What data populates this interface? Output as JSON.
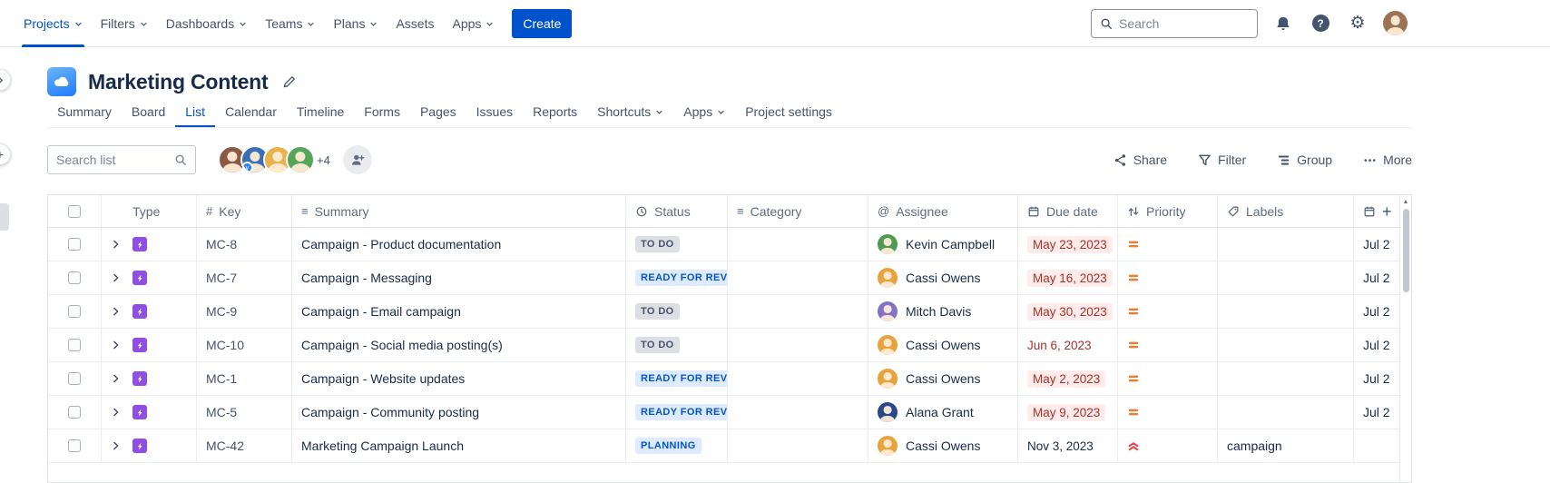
{
  "nav": {
    "items": [
      {
        "label": "Projects",
        "chevron": true,
        "active": true
      },
      {
        "label": "Filters",
        "chevron": true
      },
      {
        "label": "Dashboards",
        "chevron": true
      },
      {
        "label": "Teams",
        "chevron": true
      },
      {
        "label": "Plans",
        "chevron": true
      },
      {
        "label": "Assets",
        "chevron": false
      },
      {
        "label": "Apps",
        "chevron": true
      }
    ],
    "create_label": "Create",
    "search_placeholder": "Search"
  },
  "project": {
    "title": "Marketing Content",
    "tabs": [
      {
        "label": "Summary"
      },
      {
        "label": "Board"
      },
      {
        "label": "List",
        "active": true
      },
      {
        "label": "Calendar"
      },
      {
        "label": "Timeline"
      },
      {
        "label": "Forms"
      },
      {
        "label": "Pages"
      },
      {
        "label": "Issues"
      },
      {
        "label": "Reports"
      },
      {
        "label": "Shortcuts",
        "chevron": true
      },
      {
        "label": "Apps",
        "chevron": true
      },
      {
        "label": "Project settings"
      }
    ]
  },
  "toolbar": {
    "search_placeholder": "Search list",
    "avatars": [
      {
        "color": "#8A5A44"
      },
      {
        "color": "#3B6FB5",
        "badge": "v"
      },
      {
        "color": "#E8B34B"
      },
      {
        "color": "#55A55A"
      }
    ],
    "overflow": "+4",
    "actions": [
      {
        "label": "Share",
        "icon": "share-icon"
      },
      {
        "label": "Filter",
        "icon": "filter-icon"
      },
      {
        "label": "Group",
        "icon": "group-icon"
      },
      {
        "label": "More",
        "icon": "more-icon"
      }
    ]
  },
  "table": {
    "columns": [
      {
        "label": ""
      },
      {
        "label": "Type"
      },
      {
        "label": "Key",
        "icon": "hash-icon"
      },
      {
        "label": "Summary",
        "icon": "lines-icon"
      },
      {
        "label": "Status",
        "icon": "status-icon"
      },
      {
        "label": "Category",
        "icon": "lines-icon"
      },
      {
        "label": "Assignee",
        "icon": "at-icon"
      },
      {
        "label": "Due date",
        "icon": "calendar-icon"
      },
      {
        "label": "Priority",
        "icon": "priority-icon"
      },
      {
        "label": "Labels",
        "icon": "tag-icon"
      },
      {
        "label": "",
        "icon": "calendar-icon"
      }
    ],
    "rows": [
      {
        "key": "MC-8",
        "summary": "Campaign - Product documentation",
        "status": "TO DO",
        "status_variant": "gray",
        "assignee": "Kevin Campbell",
        "assignee_color": "#4E9B51",
        "due": "May 23, 2023",
        "due_style": "overdue-pill",
        "priority": "medium",
        "labels": "",
        "date2": "Jul 2"
      },
      {
        "key": "MC-7",
        "summary": "Campaign - Messaging",
        "status": "READY FOR REVI...",
        "status_variant": "blue",
        "assignee": "Cassi Owens",
        "assignee_color": "#E8A33D",
        "due": "May 16, 2023",
        "due_style": "overdue-pill",
        "priority": "medium",
        "labels": "",
        "date2": "Jul 2"
      },
      {
        "key": "MC-9",
        "summary": "Campaign - Email campaign",
        "status": "TO DO",
        "status_variant": "gray",
        "assignee": "Mitch Davis",
        "assignee_color": "#8273C9",
        "due": "May 30, 2023",
        "due_style": "overdue-pill",
        "priority": "medium",
        "labels": "",
        "date2": "Jul 2"
      },
      {
        "key": "MC-10",
        "summary": "Campaign - Social media posting(s)",
        "status": "TO DO",
        "status_variant": "gray",
        "assignee": "Cassi Owens",
        "assignee_color": "#E8A33D",
        "due": "Jun 6, 2023",
        "due_style": "overdue-text",
        "priority": "medium",
        "labels": "",
        "date2": "Jul 2"
      },
      {
        "key": "MC-1",
        "summary": "Campaign - Website updates",
        "status": "READY FOR REVI...",
        "status_variant": "blue",
        "assignee": "Cassi Owens",
        "assignee_color": "#E8A33D",
        "due": "May 2, 2023",
        "due_style": "overdue-pill",
        "priority": "medium",
        "labels": "",
        "date2": "Jul 2"
      },
      {
        "key": "MC-5",
        "summary": "Campaign - Community posting",
        "status": "READY FOR REVI...",
        "status_variant": "blue",
        "assignee": "Alana Grant",
        "assignee_color": "#27488A",
        "due": "May 9, 2023",
        "due_style": "overdue-pill",
        "priority": "medium",
        "labels": "",
        "date2": "Jul 2"
      },
      {
        "key": "MC-42",
        "summary": "Marketing Campaign Launch",
        "status": "PLANNING",
        "status_variant": "blue",
        "assignee": "Cassi Owens",
        "assignee_color": "#E8A33D",
        "due": "Nov 3, 2023",
        "due_style": "normal",
        "priority": "high",
        "labels": "campaign",
        "date2": "",
        "expandable": true
      }
    ]
  },
  "colors": {
    "accent": "#0052CC",
    "status_todo_bg": "#DCDFE4",
    "status_blue_bg": "#DEEBFF",
    "overdue_text": "#AE2E24",
    "overdue_bg": "#FFECEB",
    "priority_medium": "#E97F33",
    "priority_high": "#E9494A",
    "epic_purple": "#904EE2"
  }
}
